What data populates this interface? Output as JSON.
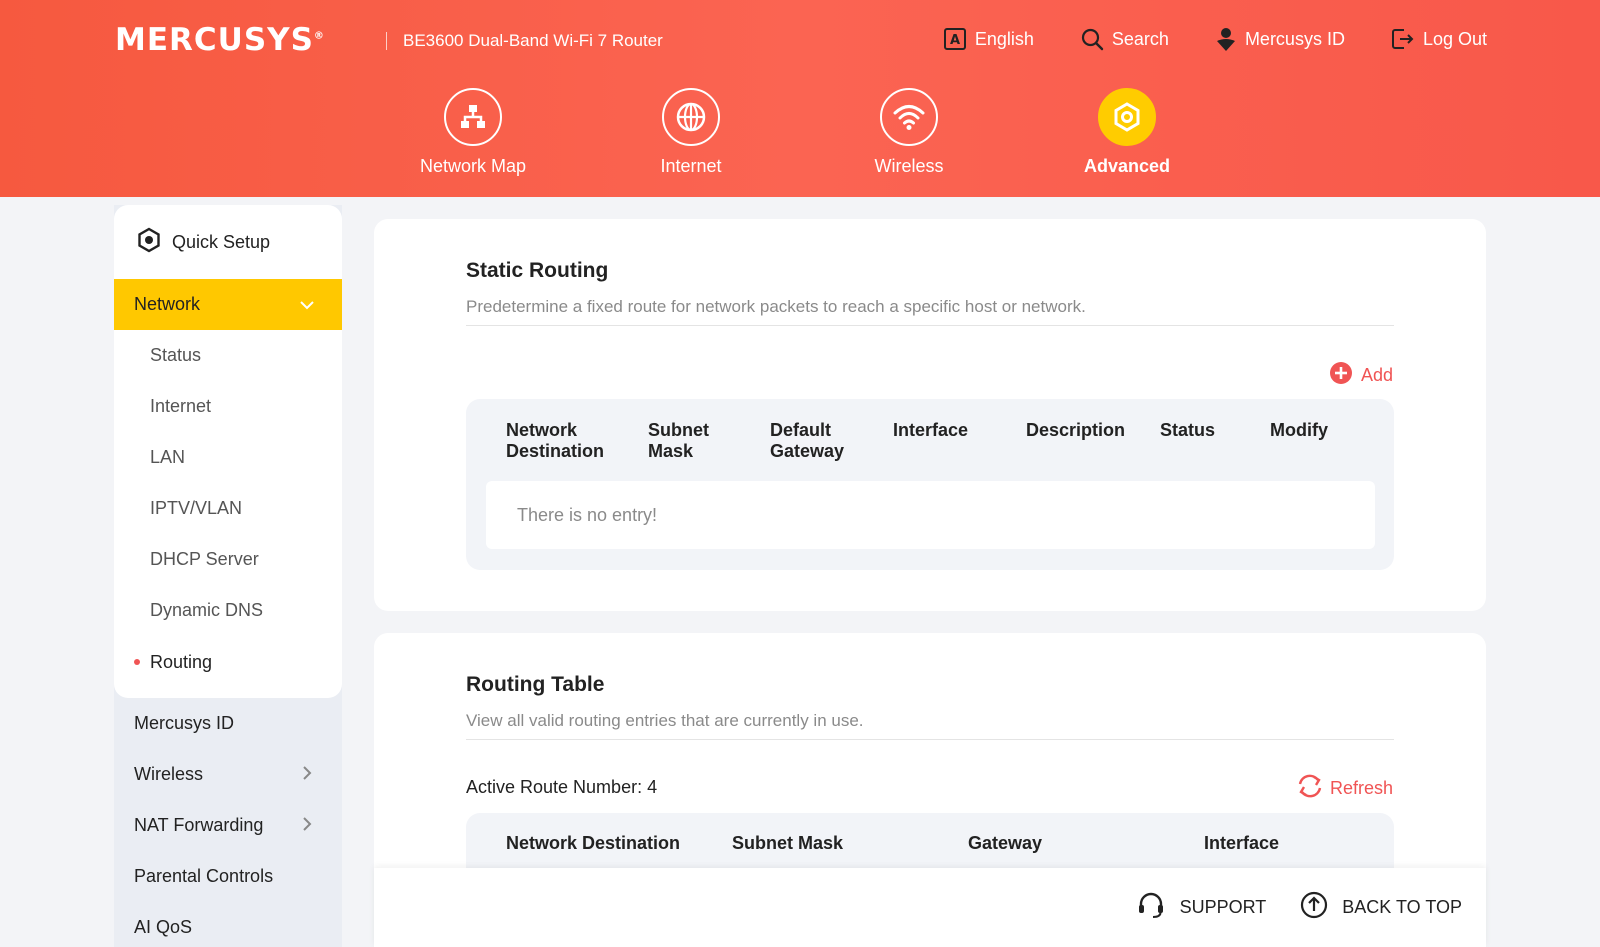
{
  "header": {
    "logo": "MERCUSYS",
    "logo_mark": "®",
    "product": "BE3600 Dual-Band Wi-Fi 7 Router",
    "actions": [
      {
        "label": "English",
        "icon": "language-icon"
      },
      {
        "label": "Search",
        "icon": "search-icon"
      },
      {
        "label": "Mercusys ID",
        "icon": "user-icon"
      },
      {
        "label": "Log Out",
        "icon": "logout-icon"
      }
    ]
  },
  "mainnav": [
    {
      "label": "Network Map",
      "icon": "network-map-icon"
    },
    {
      "label": "Internet",
      "icon": "globe-icon"
    },
    {
      "label": "Wireless",
      "icon": "wifi-icon"
    },
    {
      "label": "Advanced",
      "icon": "gear-icon",
      "active": true
    }
  ],
  "sidebar": {
    "quick_setup": "Quick Setup",
    "network": "Network",
    "network_items": [
      "Status",
      "Internet",
      "LAN",
      "IPTV/VLAN",
      "DHCP Server",
      "Dynamic DNS",
      "Routing"
    ],
    "active_item": "Routing",
    "other_items": [
      "Mercusys ID",
      "Wireless",
      "NAT Forwarding",
      "Parental Controls",
      "AI QoS"
    ]
  },
  "static_routing": {
    "title": "Static Routing",
    "description": "Predetermine a fixed route for network packets to reach a specific host or network.",
    "add_label": "Add",
    "columns": [
      "Network\nDestination",
      "Subnet\nMask",
      "Default\nGateway",
      "Interface",
      "Description",
      "Status",
      "Modify"
    ],
    "empty_text": "There is no entry!"
  },
  "routing_table": {
    "title": "Routing Table",
    "description": "View all valid routing entries that are currently in use.",
    "active_route_label": "Active Route Number: 4",
    "refresh_label": "Refresh",
    "columns": [
      "Network Destination",
      "Subnet Mask",
      "Gateway",
      "Interface"
    ]
  },
  "footer": {
    "support": "SUPPORT",
    "back_to_top": "BACK TO TOP"
  },
  "colors": {
    "header_bg": "#f9604d",
    "accent_yellow": "#ffc800",
    "accent_red": "#f05454"
  }
}
